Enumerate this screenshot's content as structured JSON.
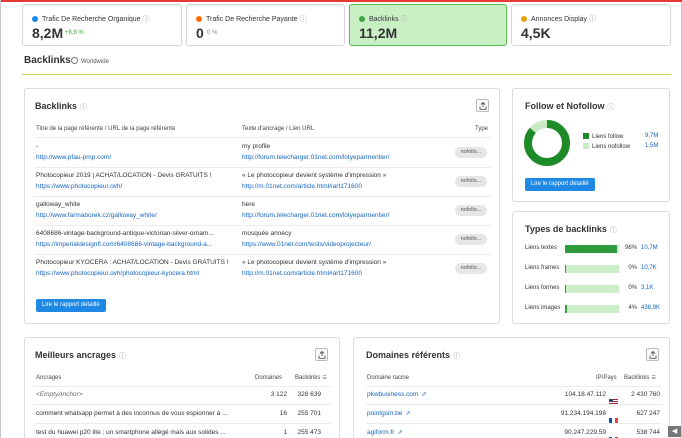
{
  "kpis": [
    {
      "title": "Trafic De Recherche Organique",
      "value": "8,2M",
      "delta": "+8,8 %",
      "dot": "#1e88e5",
      "delta_color": "#43a047"
    },
    {
      "title": "Trafic De Recherche Payante",
      "value": "0",
      "delta": "0 %",
      "dot": "#ff6d00",
      "delta_color": "#888888"
    },
    {
      "title": "Backlinks",
      "value": "11,2M",
      "delta": "",
      "dot": "#43a047",
      "delta_color": "#888888"
    },
    {
      "title": "Annonces Display",
      "value": "4,5K",
      "delta": "",
      "dot": "#e6a100",
      "delta_color": "#888888"
    }
  ],
  "section": {
    "title": "Backlinks",
    "scope": "Worldwide"
  },
  "backlinks": {
    "title": "Backlinks",
    "headers": {
      "source": "Titre de la page référente / URL de la page référente",
      "anchor": "Texte d'ancrage / Lien URL",
      "type": "Type"
    },
    "rows": [
      {
        "title": "-",
        "url": "http://www.pfau-pmp.com/",
        "anchor": "my profile",
        "target": "http://forum.telecharger.01net.com/lotyeparmentier/",
        "type": "nofollo..."
      },
      {
        "title": "Photocopieur 2019 | ACHAT/LOCATION - Devis GRATUITS !",
        "url": "https://www.photocopieur.ovh/",
        "anchor": "« Le photocopieur devient système d'impression »",
        "target": "http://m.01net.com/article.html#art171600",
        "type": "nofollo..."
      },
      {
        "title": "galloway_white",
        "url": "http://www.farmaborek.cz/galloway_white/",
        "anchor": "here",
        "target": "http://forum.telecharger.01net.com/lotyeparmentier/",
        "type": "nofollo..."
      },
      {
        "title": "6408686-vintage-background-antique-victorian-silver-ornam...",
        "url": "https://imperialdesignfl.com/6408686-vintage-background-a...",
        "anchor": "mosquée annecy",
        "target": "https://www.01net.com/tests/videoprojecteur/",
        "type": "nofollo..."
      },
      {
        "title": "Photocopieur KYOCERA : ACHAT/LOCATION - Devis GRATUITS !",
        "url": "https://www.photocopieur.ovh/photocopieur-kyocera.html",
        "anchor": "« Le photocopieur devient système d'impression »",
        "target": "http://m.01net.com/article.html#art171600",
        "type": "nofollo..."
      }
    ],
    "button": "Lire le rapport détaillé"
  },
  "follow": {
    "title": "Follow et Nofollow",
    "legend": [
      {
        "label": "Liens follow",
        "value": "9,7M",
        "color": "#1e8a28",
        "fraction": 0.864
      },
      {
        "label": "Liens nofollow",
        "value": "1,5M",
        "color": "#c8ebc3",
        "fraction": 0.136
      }
    ],
    "button": "Lire le rapport détaillé"
  },
  "types": {
    "title": "Types de backlinks",
    "rows": [
      {
        "label": "Liens textes",
        "pct": "96%",
        "count": "10,7M",
        "fraction": 0.96
      },
      {
        "label": "Liens frames",
        "pct": "0%",
        "count": "10,7K",
        "fraction": 0.003
      },
      {
        "label": "Liens formes",
        "pct": "0%",
        "count": "3,1K",
        "fraction": 0.001
      },
      {
        "label": "Liens images",
        "pct": "4%",
        "count": "438,9K",
        "fraction": 0.04
      }
    ]
  },
  "anchors": {
    "title": "Meilleurs ancrages",
    "headers": {
      "anchor": "Ancrages",
      "domains": "Domaines",
      "backlinks": "Backlinks"
    },
    "rows": [
      {
        "anchor": "<EmptyAnchor>",
        "domains": "3 122",
        "backlinks": "328 639"
      },
      {
        "anchor": "comment whatsapp permet à des inconnus de vous espionner à ...",
        "domains": "16",
        "backlinks": "255 701"
      },
      {
        "anchor": "test du huawei p20 lite : un smartphone allégé mais aux solides ...",
        "domains": "1",
        "backlinks": "255 473"
      }
    ]
  },
  "domains": {
    "title": "Domaines référents",
    "headers": {
      "domain": "Domaine racine",
      "ip": "IP/Pays",
      "backlinks": "Backlinks"
    },
    "rows": [
      {
        "domain": "pkwbusiness.com",
        "ip": "104.18.47.112",
        "backlinks": "2 430 760",
        "flag": "us"
      },
      {
        "domain": "pointgsm.be",
        "ip": "91.234.194.198",
        "backlinks": "627 247",
        "flag": "fr"
      },
      {
        "domain": "agiform.fr",
        "ip": "90.247.229.59",
        "backlinks": "538 744",
        "flag": "fr"
      }
    ]
  }
}
